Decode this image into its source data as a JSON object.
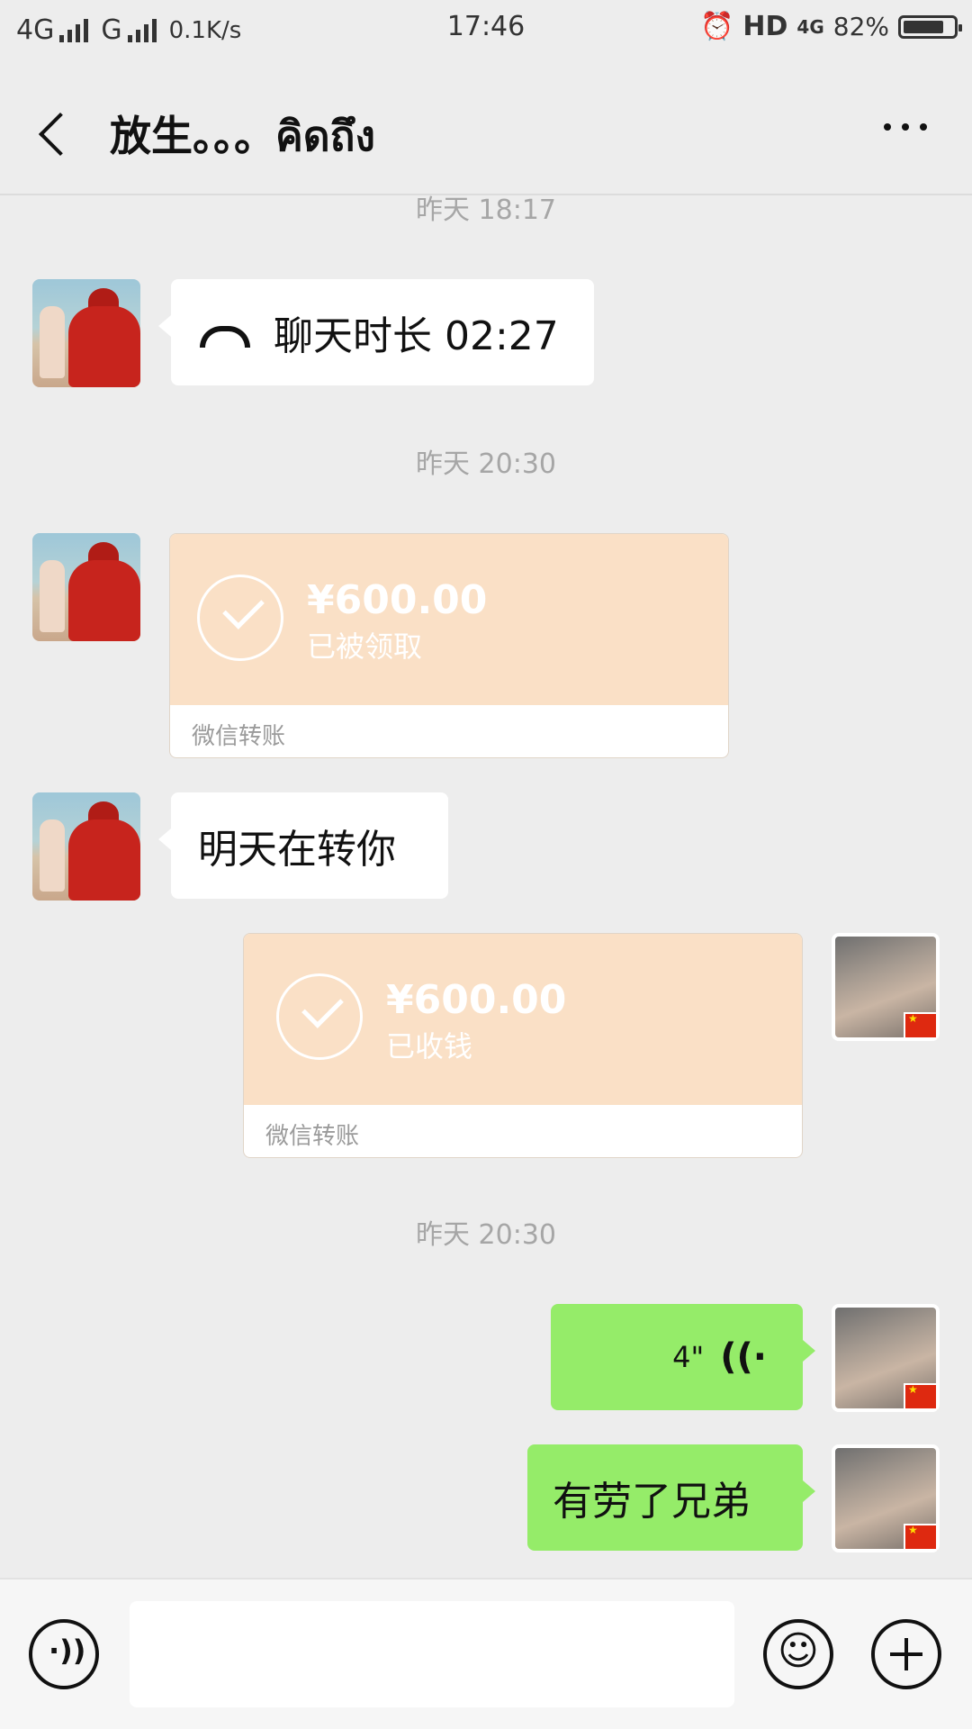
{
  "status_bar": {
    "network1": "4G",
    "network2": "G",
    "speed": "0.1K/s",
    "time": "17:46",
    "hd": "HD",
    "network3": "4G",
    "battery_text": "82%",
    "battery_level": 0.82
  },
  "header": {
    "title": "放生。。。คิดถึง"
  },
  "messages": {
    "ts1": "昨天 18:17",
    "call_text": "聊天时长 02:27",
    "ts2": "昨天 20:30",
    "transfer1": {
      "amount": "¥600.00",
      "status": "已被领取",
      "footer": "微信转账"
    },
    "text1": "明天在转你",
    "transfer2": {
      "amount": "¥600.00",
      "status": "已收钱",
      "footer": "微信转账"
    },
    "ts3": "昨天 20:30",
    "voice_duration": "4\"",
    "text2": "有劳了兄弟"
  },
  "input_bar": {
    "placeholder": ""
  },
  "colors": {
    "background": "#ededed",
    "my_bubble": "#95ec69",
    "transfer_bg": "#fae0c6"
  }
}
